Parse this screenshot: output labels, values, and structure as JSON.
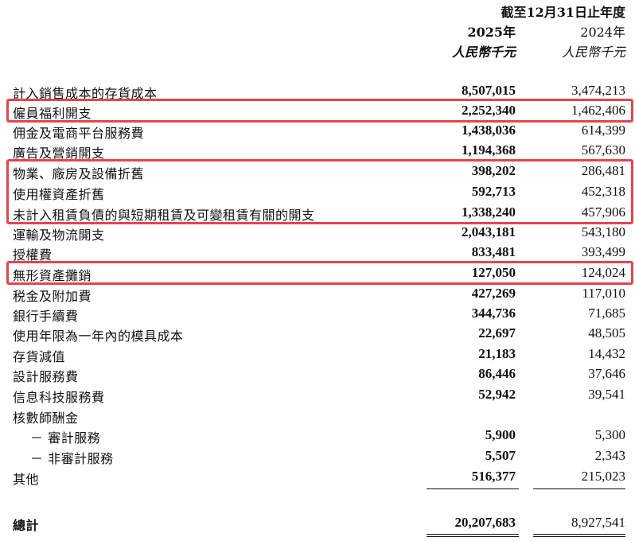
{
  "header": {
    "period": "截至12月31日止年度",
    "year_current": "2025年",
    "year_prior": "2024年",
    "unit_current": "人民幣千元",
    "unit_prior": "人民幣千元"
  },
  "rows": [
    {
      "label": "計入銷售成本的存貨成本",
      "v2025": "8,507,015",
      "v2024": "3,474,213"
    },
    {
      "label": "僱員福利開支",
      "v2025": "2,252,340",
      "v2024": "1,462,406"
    },
    {
      "label": "佣金及電商平台服務費",
      "v2025": "1,438,036",
      "v2024": "614,399"
    },
    {
      "label": "廣告及營銷開支",
      "v2025": "1,194,368",
      "v2024": "567,630"
    },
    {
      "label": "物業、廠房及設備折舊",
      "v2025": "398,202",
      "v2024": "286,481"
    },
    {
      "label": "使用權資產折舊",
      "v2025": "592,713",
      "v2024": "452,318"
    },
    {
      "label": "未計入租賃負債的與短期租賃及可變租賃有關的開支",
      "v2025": "1,338,240",
      "v2024": "457,906"
    },
    {
      "label": "運輸及物流開支",
      "v2025": "2,043,181",
      "v2024": "543,180"
    },
    {
      "label": "授權費",
      "v2025": "833,481",
      "v2024": "393,499"
    },
    {
      "label": "無形資產攤銷",
      "v2025": "127,050",
      "v2024": "124,024"
    },
    {
      "label": "税金及附加費",
      "v2025": "427,269",
      "v2024": "117,010"
    },
    {
      "label": "銀行手續費",
      "v2025": "344,736",
      "v2024": "71,685"
    },
    {
      "label": "使用年限為一年內的模具成本",
      "v2025": "22,697",
      "v2024": "48,505"
    },
    {
      "label": "存貨減值",
      "v2025": "21,183",
      "v2024": "14,432"
    },
    {
      "label": "設計服務費",
      "v2025": "86,446",
      "v2024": "37,646"
    },
    {
      "label": "信息科技服務費",
      "v2025": "52,942",
      "v2024": "39,541"
    },
    {
      "label": "核數師酬金",
      "v2025": "",
      "v2024": ""
    },
    {
      "label": "－ 審計服務",
      "v2025": "5,900",
      "v2024": "5,300"
    },
    {
      "label": "－ 非審計服務",
      "v2025": "5,507",
      "v2024": "2,343"
    },
    {
      "label": "其他",
      "v2025": "516,377",
      "v2024": "215,023"
    }
  ],
  "total": {
    "label": "總計",
    "v2025": "20,207,683",
    "v2024": "8,927,541"
  },
  "colors": {
    "highlight": "#e0474f",
    "text": "#111111"
  }
}
